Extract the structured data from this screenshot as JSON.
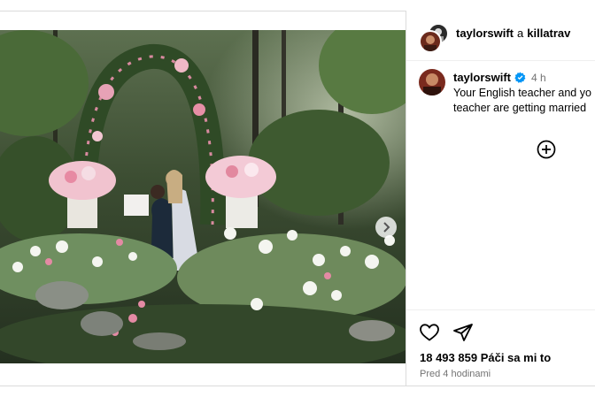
{
  "header": {
    "author": "taylorswift",
    "connector": "a",
    "collaborator": "killatrav"
  },
  "post": {
    "username": "taylorswift",
    "verified": true,
    "time_ago": "4 h",
    "caption_line1": "Your English teacher and yo",
    "caption_line2": "teacher are getting married"
  },
  "stats": {
    "likes_count": "18 493 859",
    "likes_label": "Páči sa mi to",
    "posted_label": "Pred 4 hodinami"
  },
  "icons": {
    "like": "heart-icon",
    "share": "paper-plane-icon",
    "more_comments": "plus-circle-icon",
    "next": "chevron-right-icon",
    "verified": "verified-badge-icon"
  },
  "colors": {
    "verified": "#0095f6",
    "secondary_text": "#737373",
    "divider": "#dbdbdb"
  }
}
